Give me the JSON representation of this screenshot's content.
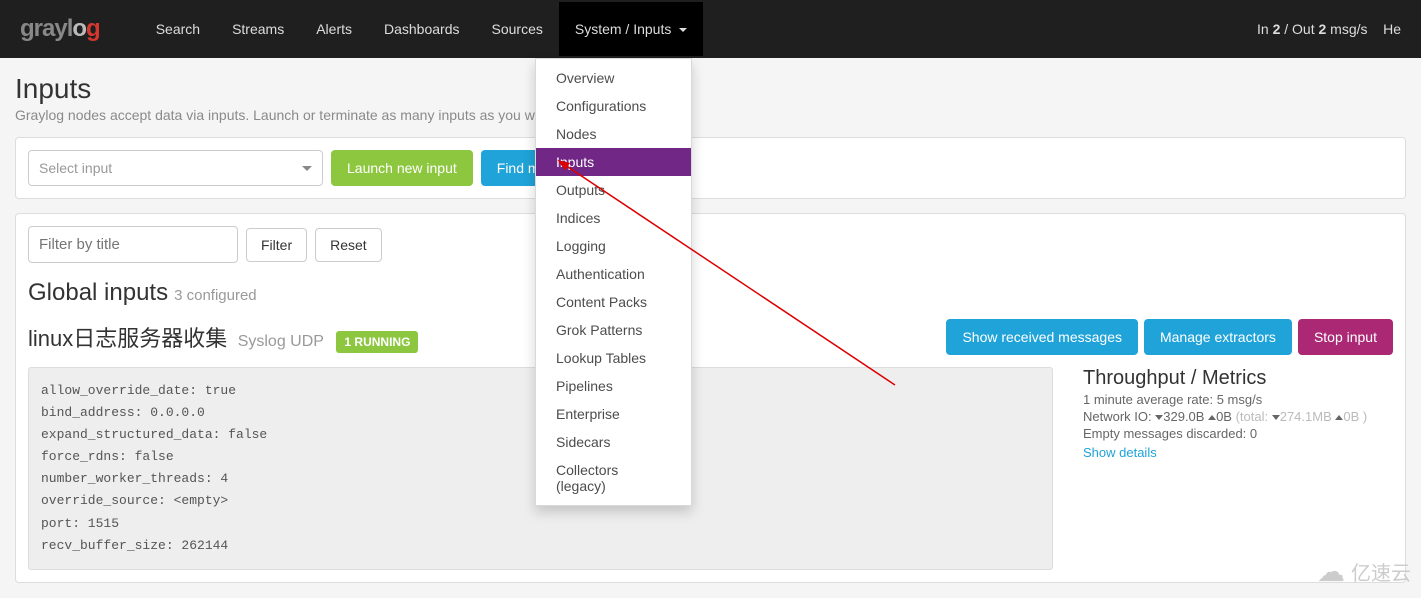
{
  "logo": {
    "part1": "gray",
    "part2": "l",
    "part3": "o",
    "part4": "g"
  },
  "nav": {
    "items": [
      "Search",
      "Streams",
      "Alerts",
      "Dashboards",
      "Sources",
      "System / Inputs"
    ],
    "right": {
      "prefix": "In ",
      "in": "2",
      "mid": " / Out ",
      "out": "2",
      "suffix": " msg/s",
      "tail": "He"
    }
  },
  "dropdown": {
    "items": [
      "Overview",
      "Configurations",
      "Nodes",
      "Inputs",
      "Outputs",
      "Indices",
      "Logging",
      "Authentication",
      "Content Packs",
      "Grok Patterns",
      "Lookup Tables",
      "Pipelines",
      "Enterprise",
      "Sidecars",
      "Collectors (legacy)"
    ],
    "selected_index": 3
  },
  "page": {
    "title": "Inputs",
    "subtitle": "Graylog nodes accept data via inputs. Launch or terminate as many inputs as you want here"
  },
  "launch": {
    "select_placeholder": "Select input",
    "launch_btn": "Launch new input",
    "find_btn": "Find m"
  },
  "filter": {
    "placeholder": "Filter by title",
    "filter_btn": "Filter",
    "reset_btn": "Reset"
  },
  "global": {
    "heading": "Global inputs",
    "count": "3 configured"
  },
  "input": {
    "name": "linux日志服务器收集",
    "type": "Syslog UDP",
    "status": "1 RUNNING",
    "actions": {
      "show": "Show received messages",
      "manage": "Manage extractors",
      "stop": "Stop input"
    }
  },
  "config": {
    "lines": [
      "allow_override_date: true",
      "bind_address: 0.0.0.0",
      "expand_structured_data: false",
      "force_rdns: false",
      "number_worker_threads: 4",
      "override_source: <empty>",
      "port: 1515",
      "recv_buffer_size: 262144"
    ]
  },
  "metrics": {
    "title": "Throughput / Metrics",
    "avg": "1 minute average rate: 5 msg/s",
    "netio_label": "Network IO: ",
    "netio_down": "329.0B ",
    "netio_up": "0B ",
    "netio_total": "(total: ",
    "netio_total_down": "274.1MB ",
    "netio_total_up": "0B ",
    "netio_total_end": ")",
    "empty": "Empty messages discarded: 0",
    "details": "Show details"
  },
  "watermark": "亿速云"
}
